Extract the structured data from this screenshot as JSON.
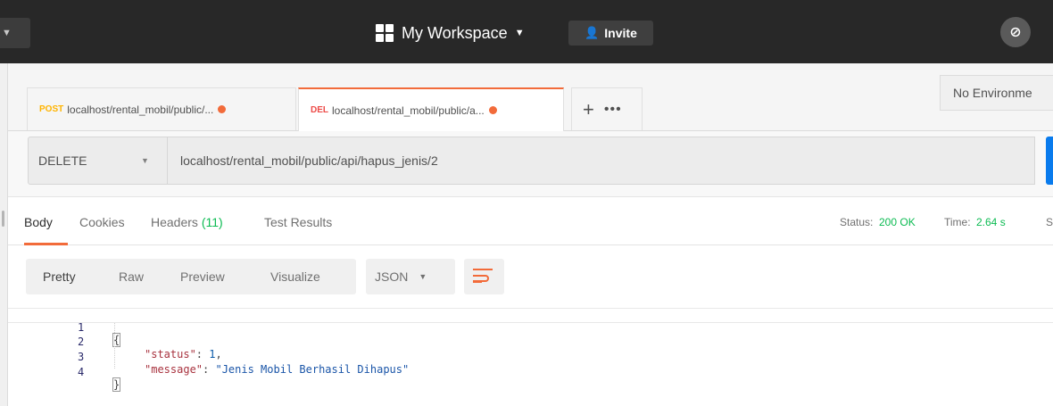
{
  "topbar": {
    "workspace_label": "My Workspace",
    "invite_label": "Invite"
  },
  "tabs": [
    {
      "method": "POST",
      "url": "localhost/rental_mobil/public/..."
    },
    {
      "method": "DEL",
      "url": "localhost/rental_mobil/public/a..."
    }
  ],
  "environment": {
    "label": "No Environme"
  },
  "request": {
    "method": "DELETE",
    "url": "localhost/rental_mobil/public/api/hapus_jenis/2"
  },
  "response_tabs": {
    "body": "Body",
    "cookies": "Cookies",
    "headers": "Headers",
    "headers_count": "(11)",
    "test_results": "Test Results"
  },
  "response_status": {
    "status_label": "Status:",
    "status_value": "200 OK",
    "time_label": "Time:",
    "time_value": "2.64 s",
    "size_label": "S"
  },
  "toolbar": {
    "pretty": "Pretty",
    "raw": "Raw",
    "preview": "Preview",
    "visualize": "Visualize",
    "format": "JSON"
  },
  "code": {
    "line_numbers": [
      "1",
      "2",
      "3",
      "4"
    ],
    "open_brace": "{",
    "close_brace": "}",
    "key_status": "\"status\"",
    "val_status": "1",
    "key_message": "\"message\"",
    "val_message": "\"Jenis Mobil Berhasil Dihapus\""
  },
  "colors": {
    "accent": "#f26b3a",
    "success": "#0cbb52",
    "post": "#ffb400",
    "delete": "#ed4b48",
    "send": "#097bed"
  }
}
